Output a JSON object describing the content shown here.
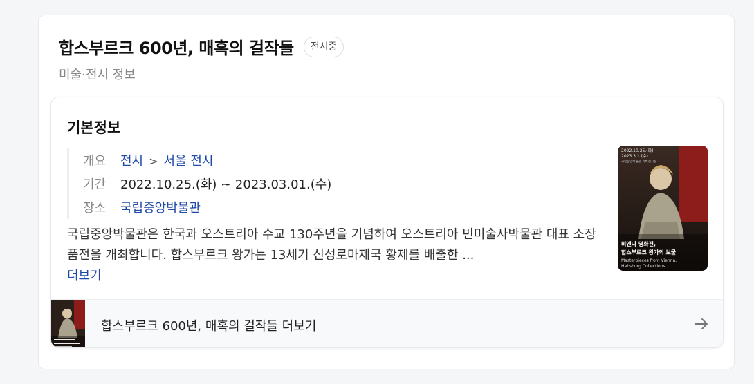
{
  "header": {
    "title": "합스부르크 600년, 매혹의 걸작들",
    "badge": "전시중",
    "subtitle": "미술·전시 정보"
  },
  "basic_info": {
    "section_title": "기본정보",
    "overview_label": "개요",
    "overview_crumb1": "전시",
    "overview_sep": ">",
    "overview_crumb2": "서울 전시",
    "period_label": "기간",
    "period_value": "2022.10.25.(화) ~ 2023.03.01.(수)",
    "venue_label": "장소",
    "venue_value": "국립중앙박물관",
    "description": "국립중앙박물관은 한국과 오스트리아 수교 130주년을 기념하여 오스트리아 빈미술사박물관 대표 소장품전을 개최합니다. 합스부르크 왕가는 13세기 신성로마제국 황제를 배출한 ...",
    "more_label": "더보기"
  },
  "poster": {
    "dates": "2022.10.25.(화) —",
    "dates2": "2023.3.1.(수)",
    "venue": "국립중앙박물관 기획전시실",
    "title_ko_line1": "비엔나 명화전,",
    "title_ko_line2": "합스부르크 왕가의 보물",
    "title_en_line1": "Masterpieces from Vienna,",
    "title_en_line2": "Habsburg Collections"
  },
  "footer": {
    "link_text": "합스부르크 600년, 매혹의 걸작들 더보기"
  },
  "colors": {
    "link": "#1f4aa8",
    "poster_bg": "#2b1f1a",
    "poster_accent": "#8c1d1a"
  }
}
